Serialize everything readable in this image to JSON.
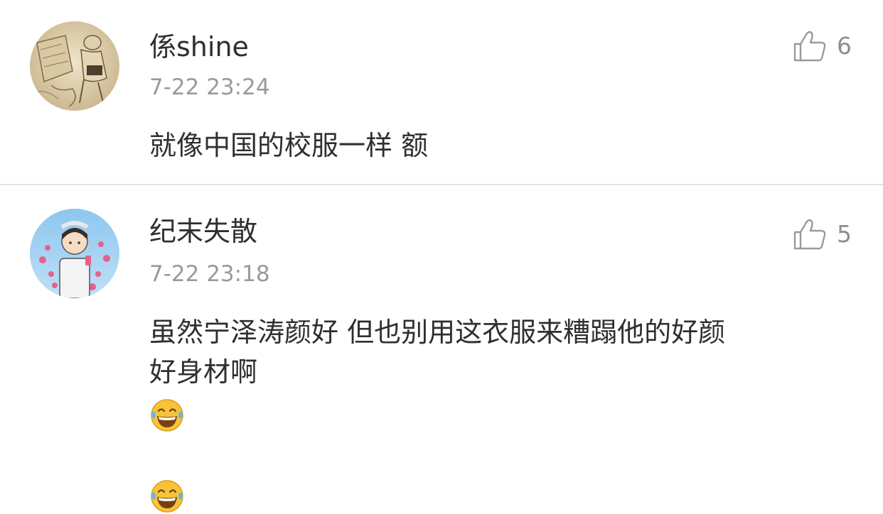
{
  "comments": [
    {
      "username": "係shine",
      "timestamp": "7-22 23:24",
      "text": "就像中国的校服一样 额",
      "likes": "6",
      "avatar": "sketch-illustration-avatar",
      "like_icon": "thumbs-up-icon"
    },
    {
      "username": "纪末失散",
      "timestamp": "7-22 23:18",
      "text_line1": "虽然宁泽涛颜好 但也别用这衣服来糟蹋他的好颜",
      "text_line2": "好身材啊",
      "emojis": [
        "laughing-tears-emoji",
        "laughing-tears-emoji"
      ],
      "likes": "5",
      "avatar": "cartoon-girl-avatar",
      "like_icon": "thumbs-up-icon"
    }
  ],
  "colors": {
    "text": "#2f2f2f",
    "meta": "#9a9a9a",
    "divider": "#e2e2e2",
    "emoji_face": "#f7c33a"
  }
}
